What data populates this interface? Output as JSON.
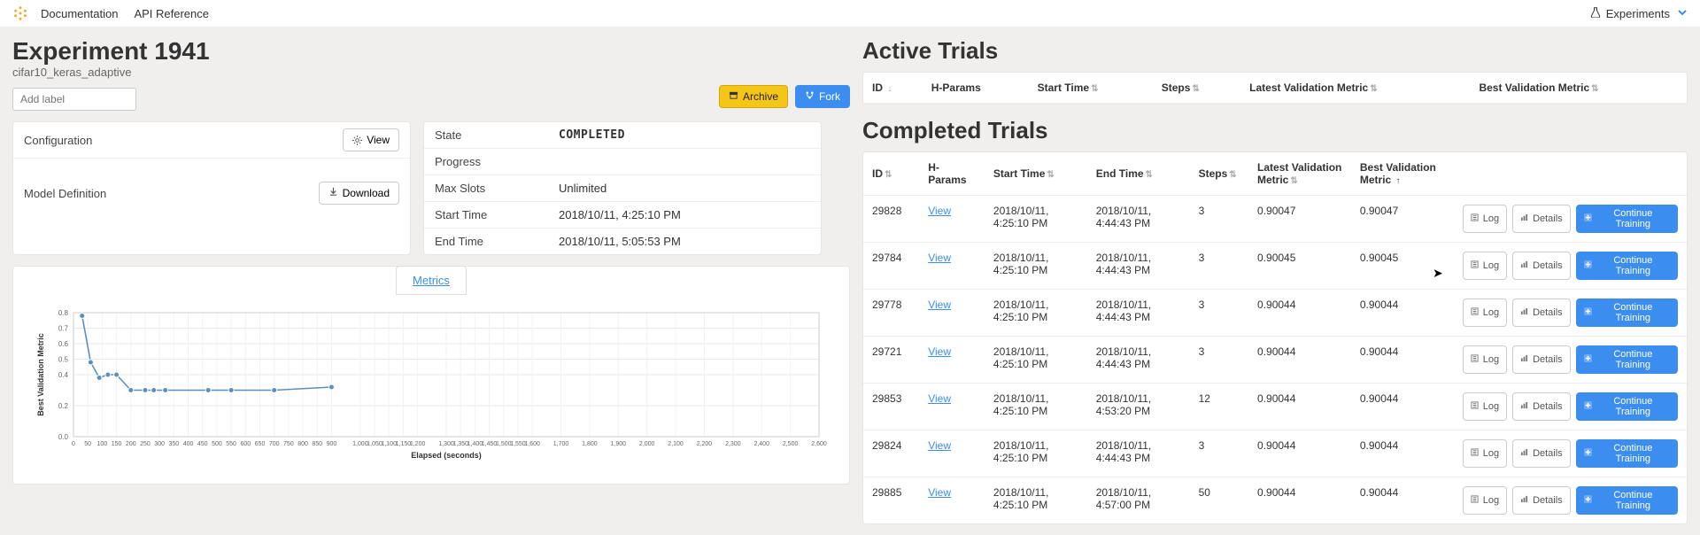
{
  "nav": {
    "doc": "Documentation",
    "api": "API Reference",
    "experiments": "Experiments"
  },
  "experiment": {
    "title": "Experiment 1941",
    "subtitle": "cifar10_keras_adaptive",
    "addlabel_placeholder": "Add label",
    "archive": "Archive",
    "fork": "Fork"
  },
  "config": {
    "configuration": "Configuration",
    "view": "View",
    "model_def": "Model Definition",
    "download": "Download"
  },
  "status": {
    "state_k": "State",
    "state_v": "COMPLETED",
    "progress_k": "Progress",
    "maxslots_k": "Max Slots",
    "maxslots_v": "Unlimited",
    "start_k": "Start Time",
    "start_v": "2018/10/11, 4:25:10 PM",
    "end_k": "End Time",
    "end_v": "2018/10/11, 5:05:53 PM"
  },
  "chart": {
    "tab": "Metrics"
  },
  "chart_data": {
    "type": "line",
    "title": "",
    "xlabel": "Elapsed (seconds)",
    "ylabel": "Best Validation Metric",
    "xlim": [
      0,
      2600
    ],
    "ylim": [
      0.0,
      0.8
    ],
    "xticks": [
      0,
      50,
      100,
      150,
      200,
      250,
      300,
      350,
      400,
      450,
      500,
      550,
      600,
      650,
      700,
      750,
      800,
      850,
      900,
      1000,
      1050,
      1100,
      1150,
      1200,
      1300,
      1350,
      1400,
      1450,
      1500,
      1550,
      1600,
      1700,
      1800,
      1900,
      2000,
      2100,
      2200,
      2300,
      2400,
      2500,
      2600
    ],
    "yticks": [
      0.0,
      0.2,
      0.4,
      0.5,
      0.6,
      0.7,
      0.8
    ],
    "series": [
      {
        "name": "best_validation_metric",
        "x": [
          30,
          60,
          90,
          120,
          150,
          200,
          250,
          280,
          320,
          470,
          550,
          700,
          900
        ],
        "y": [
          0.78,
          0.48,
          0.38,
          0.4,
          0.4,
          0.3,
          0.3,
          0.3,
          0.3,
          0.3,
          0.3,
          0.3,
          0.32
        ]
      }
    ]
  },
  "active_title": "Active Trials",
  "completed_title": "Completed Trials",
  "active_headers": {
    "id": "ID",
    "hparams": "H-Params",
    "start": "Start Time",
    "steps": "Steps",
    "latest": "Latest Validation Metric",
    "best": "Best Validation Metric"
  },
  "completed_headers": {
    "id": "ID",
    "hparams": "H-Params",
    "start": "Start Time",
    "end": "End Time",
    "steps": "Steps",
    "latest": "Latest Validation Metric",
    "best": "Best Validation Metric"
  },
  "row_actions": {
    "log": "Log",
    "details": "Details",
    "continue": "Continue Training",
    "view": "View"
  },
  "completed_rows": [
    {
      "id": "29828",
      "start": "2018/10/11, 4:25:10 PM",
      "end": "2018/10/11, 4:44:43 PM",
      "steps": "3",
      "latest": "0.90047",
      "best": "0.90047"
    },
    {
      "id": "29784",
      "start": "2018/10/11, 4:25:10 PM",
      "end": "2018/10/11, 4:44:43 PM",
      "steps": "3",
      "latest": "0.90045",
      "best": "0.90045"
    },
    {
      "id": "29778",
      "start": "2018/10/11, 4:25:10 PM",
      "end": "2018/10/11, 4:44:43 PM",
      "steps": "3",
      "latest": "0.90044",
      "best": "0.90044"
    },
    {
      "id": "29721",
      "start": "2018/10/11, 4:25:10 PM",
      "end": "2018/10/11, 4:44:43 PM",
      "steps": "3",
      "latest": "0.90044",
      "best": "0.90044"
    },
    {
      "id": "29853",
      "start": "2018/10/11, 4:25:10 PM",
      "end": "2018/10/11, 4:53:20 PM",
      "steps": "12",
      "latest": "0.90044",
      "best": "0.90044"
    },
    {
      "id": "29824",
      "start": "2018/10/11, 4:25:10 PM",
      "end": "2018/10/11, 4:44:43 PM",
      "steps": "3",
      "latest": "0.90044",
      "best": "0.90044"
    },
    {
      "id": "29885",
      "start": "2018/10/11, 4:25:10 PM",
      "end": "2018/10/11, 4:57:00 PM",
      "steps": "50",
      "latest": "0.90044",
      "best": "0.90044"
    }
  ]
}
